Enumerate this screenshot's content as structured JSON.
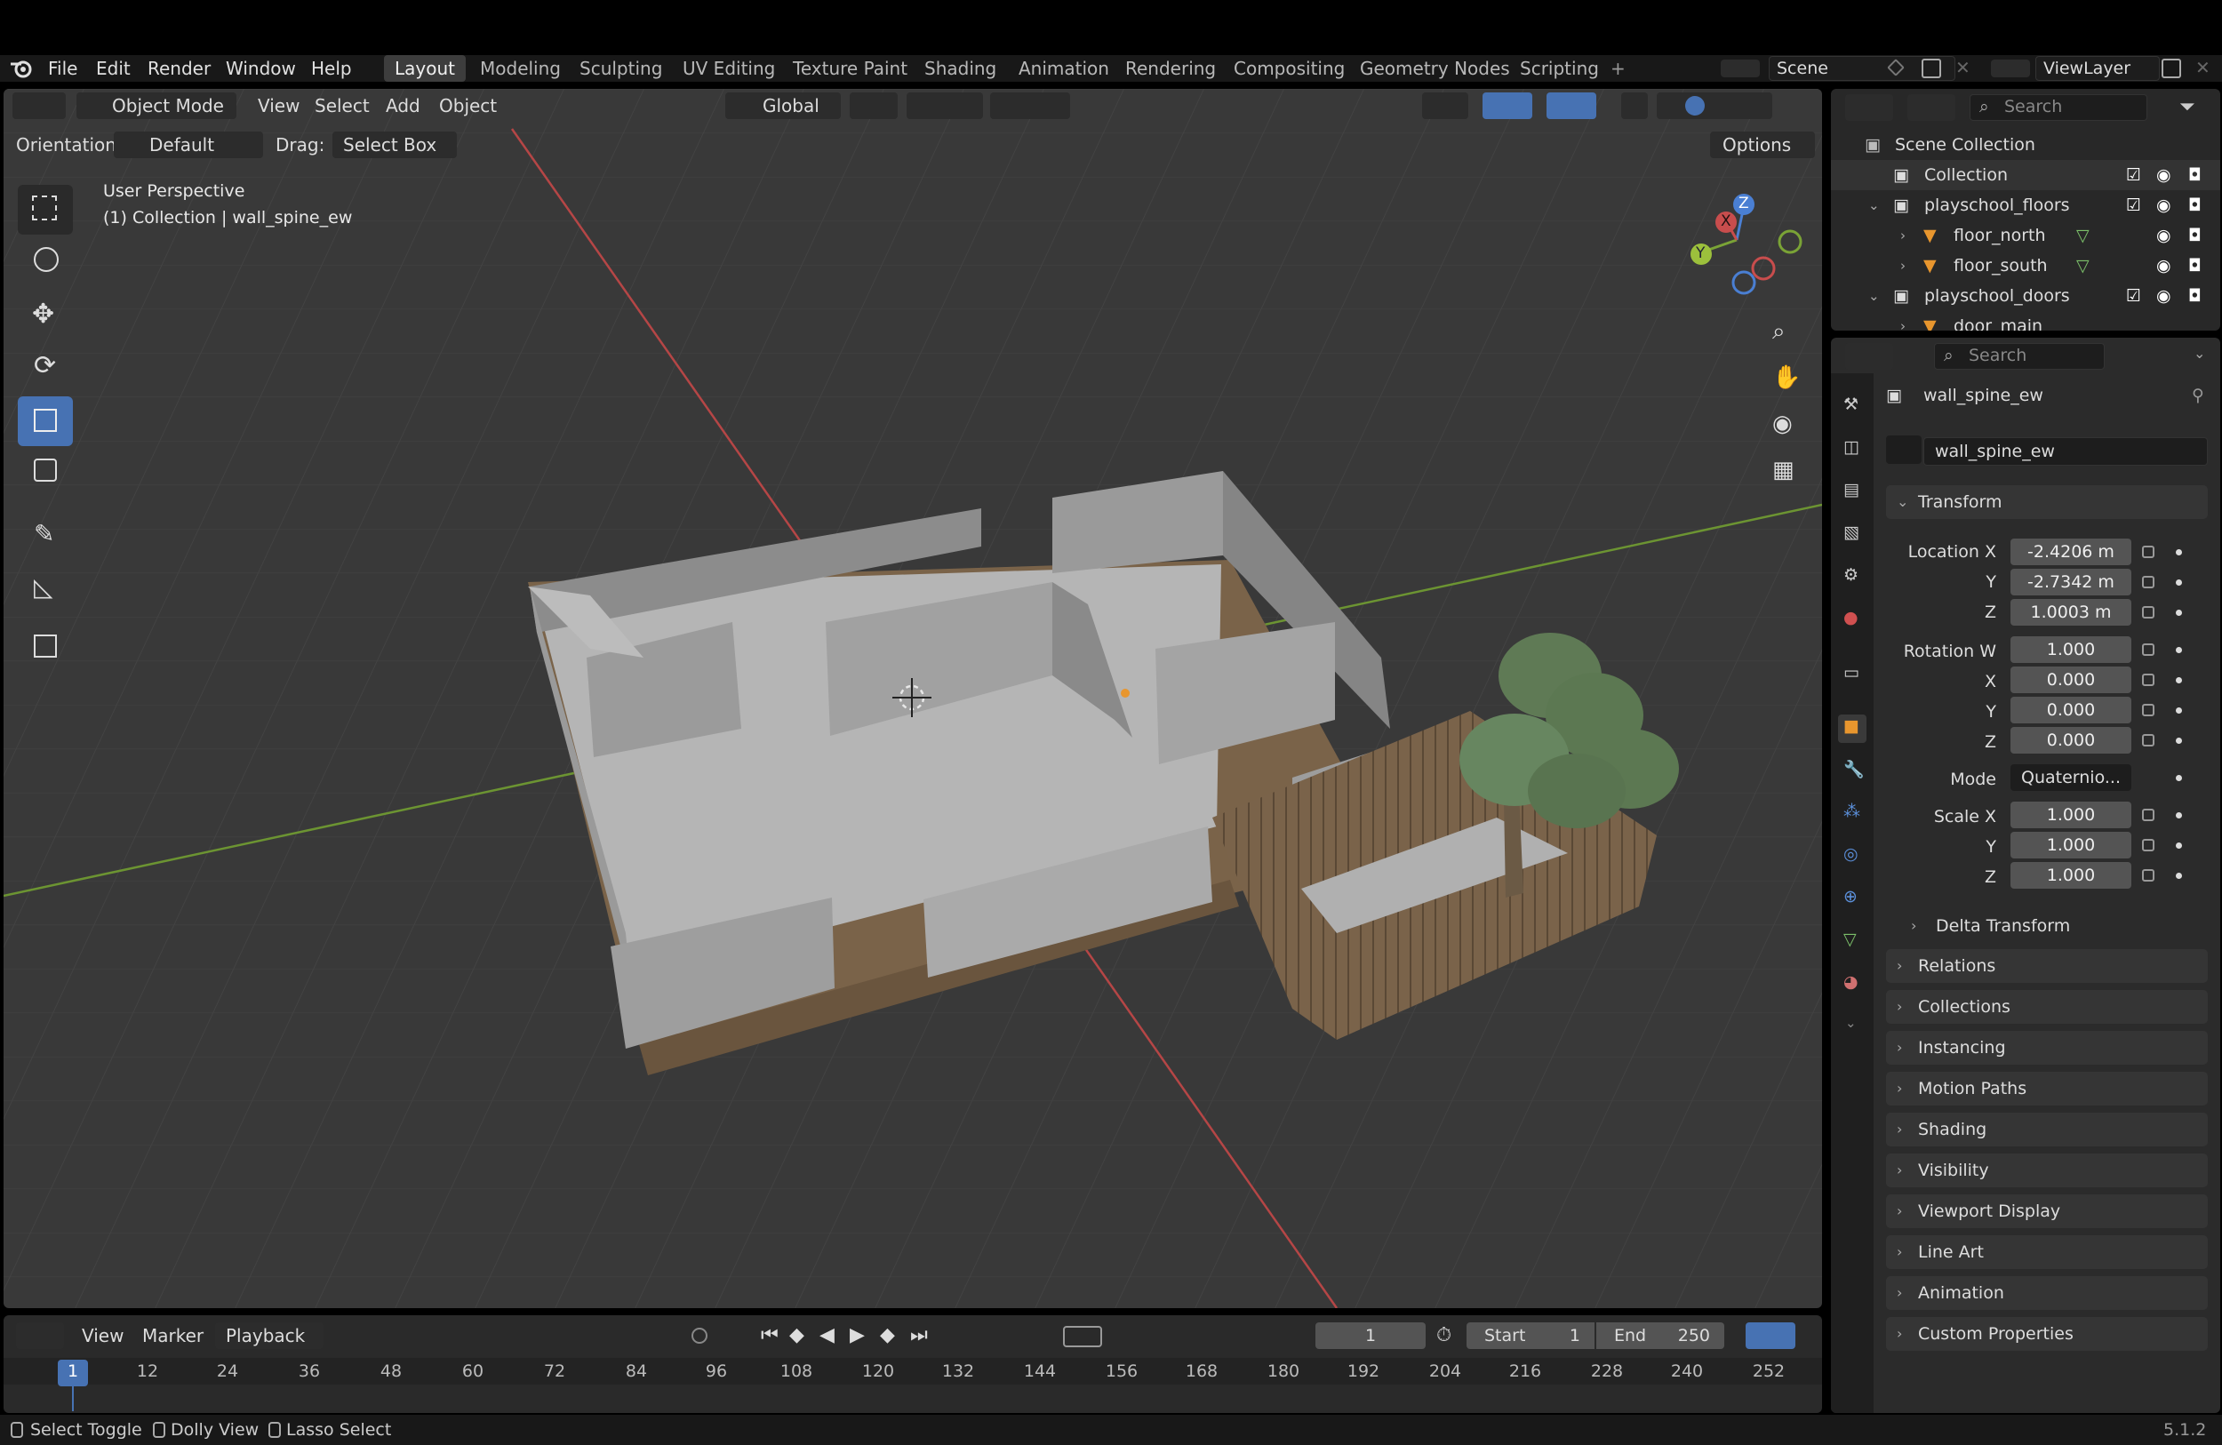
{
  "topbar": {
    "menus": [
      "File",
      "Edit",
      "Render",
      "Window",
      "Help"
    ],
    "workspaces": [
      "Layout",
      "Modeling",
      "Sculpting",
      "UV Editing",
      "Texture Paint",
      "Shading",
      "Animation",
      "Rendering",
      "Compositing",
      "Geometry Nodes",
      "Scripting"
    ],
    "active_workspace": "Layout",
    "add_tab": "+",
    "scene": "Scene",
    "view_layer": "ViewLayer"
  },
  "viewport": {
    "mode": "Object Mode",
    "menus": [
      "View",
      "Select",
      "Add",
      "Object"
    ],
    "transform_orientation": "Global",
    "orientation_label": "Orientation:",
    "orientation_value": "Default",
    "drag_label": "Drag:",
    "drag_value": "Select Box",
    "options_label": "Options",
    "overlay_line1": "User Perspective",
    "overlay_line2": "(1) Collection | wall_spine_ew",
    "gizmo": {
      "x": "X",
      "y": "Y",
      "z": "Z"
    }
  },
  "outliner": {
    "search_placeholder": "Search",
    "rows": [
      {
        "label": "Scene Collection"
      },
      {
        "label": "Collection"
      },
      {
        "label": "playschool_floors"
      },
      {
        "label": "floor_north"
      },
      {
        "label": "floor_south"
      },
      {
        "label": "playschool_doors"
      },
      {
        "label": "door_main"
      }
    ]
  },
  "properties": {
    "search_placeholder": "Search",
    "object_name": "wall_spine_ew",
    "object_data_name": "wall_spine_ew",
    "transform_title": "Transform",
    "location_label": "Location X",
    "location": [
      "-2.4206 m",
      "-2.7342 m",
      "1.0003 m"
    ],
    "rotation_label": "Rotation W",
    "rotation": [
      "1.000",
      "0.000",
      "0.000",
      "0.000"
    ],
    "mode_label": "Mode",
    "mode_value": "Quaternio...",
    "scale_label": "Scale X",
    "scale": [
      "1.000",
      "1.000",
      "1.000"
    ],
    "axis_y": "Y",
    "axis_z": "Z",
    "axis_x": "X",
    "delta_transform": "Delta Transform",
    "panels": [
      "Relations",
      "Collections",
      "Instancing",
      "Motion Paths",
      "Shading",
      "Visibility",
      "Viewport Display",
      "Line Art",
      "Animation",
      "Custom Properties"
    ]
  },
  "timeline": {
    "menus": [
      "View",
      "Marker",
      "Playback"
    ],
    "current_frame": "1",
    "start_label": "Start",
    "start": "1",
    "end_label": "End",
    "end": "250",
    "ruler": [
      "1",
      "12",
      "24",
      "36",
      "48",
      "60",
      "72",
      "84",
      "96",
      "108",
      "120",
      "132",
      "144",
      "156",
      "168",
      "180",
      "192",
      "204",
      "216",
      "228",
      "240",
      "252"
    ]
  },
  "statusbar": {
    "items": [
      "Select Toggle",
      "Dolly View",
      "Lasso Select"
    ],
    "version": "5.1.2"
  },
  "colors": {
    "accent": "#4772b3",
    "x_axis": "#c84d4d",
    "y_axis": "#7aa336",
    "z_axis": "#4a7fd3"
  }
}
